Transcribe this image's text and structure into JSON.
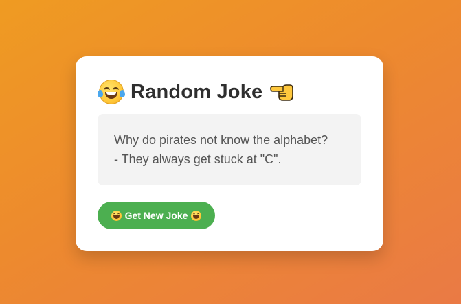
{
  "card": {
    "title": "Random Joke",
    "title_left_icon": "laughing-face-with-tears-icon",
    "title_right_icon": "backhand-index-pointing-left-icon"
  },
  "joke": {
    "setup": "Why do pirates not know the alphabet?",
    "punchline": "- They always get stuck at \"C\"."
  },
  "button": {
    "label": "Get New Joke",
    "icon": "grinning-squinting-face-icon"
  },
  "colors": {
    "background_gradient_start": "#ef9b22",
    "background_gradient_end": "#ea7a45",
    "card": "#ffffff",
    "joke_box": "#f3f3f3",
    "button": "#4caf50",
    "title_text": "#2f2f2f",
    "joke_text": "#555555"
  }
}
